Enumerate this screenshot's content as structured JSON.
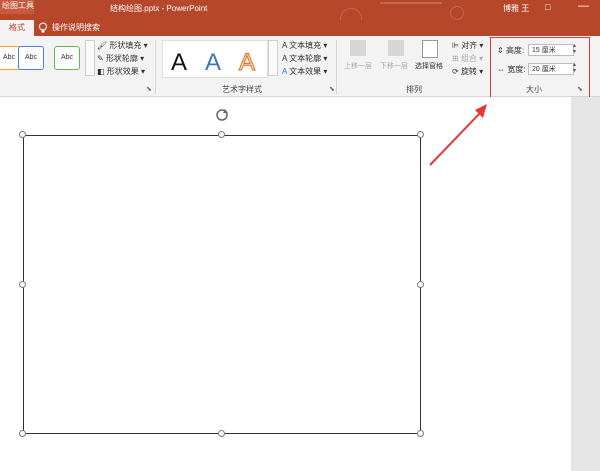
{
  "titlebar": {
    "context_tab": "绘图工具",
    "doc_title": "结构绘图.pptx - PowerPoint",
    "user": "博雅 王",
    "restore": "□"
  },
  "tabs": {
    "active": "格式",
    "tellme": "操作说明搜索"
  },
  "shape_styles": {
    "swatches": [
      "Abc",
      "Abc",
      "Abc"
    ],
    "fill": "形状填充",
    "outline": "形状轮廓",
    "effects": "形状效果"
  },
  "wordart": {
    "letters": [
      "A",
      "A",
      "A"
    ],
    "fill": "文本填充",
    "outline": "文本轮廓",
    "effects": "文本效果",
    "group_label": "艺术字样式"
  },
  "arrange": {
    "bring_forward": "上移一层",
    "send_backward": "下移一层",
    "selection_pane": "选择窗格",
    "align": "对齐",
    "group": "组合",
    "rotate": "旋转",
    "group_label": "排列"
  },
  "size": {
    "height_label": "高度:",
    "height_value": "15 厘米",
    "width_label": "宽度:",
    "width_value": "20 厘米",
    "group_label": "大小"
  },
  "colors": {
    "accent": "#b7472a",
    "highlight": "#e53935"
  }
}
